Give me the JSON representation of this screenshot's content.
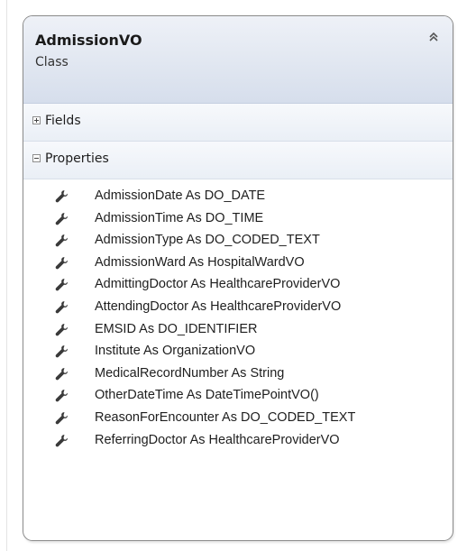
{
  "class": {
    "name": "AdmissionVO",
    "kind": "Class",
    "collapse_icon": "double-chevron-up-icon"
  },
  "sections": [
    {
      "label": "Fields",
      "state": "collapsed",
      "toggle_icon": "expand-plus-icon"
    },
    {
      "label": "Properties",
      "state": "expanded",
      "toggle_icon": "collapse-minus-icon"
    }
  ],
  "properties": [
    "AdmissionDate As DO_DATE",
    "AdmissionTime As DO_TIME",
    "AdmissionType As DO_CODED_TEXT",
    "AdmissionWard As HospitalWardVO",
    "AdmittingDoctor As HealthcareProviderVO",
    "AttendingDoctor As HealthcareProviderVO",
    "EMSID As DO_IDENTIFIER",
    "Institute As OrganizationVO",
    "MedicalRecordNumber As String",
    "OtherDateTime As DateTimePointVO()",
    "ReasonForEncounter As DO_CODED_TEXT",
    "ReferringDoctor As HealthcareProviderVO"
  ],
  "property_icon": "wrench-icon",
  "colors": {
    "header_gradient_top": "#eef1f7",
    "header_gradient_bottom": "#d6deec",
    "border": "#8a8a8a",
    "wrench": "#3a3a3a"
  }
}
